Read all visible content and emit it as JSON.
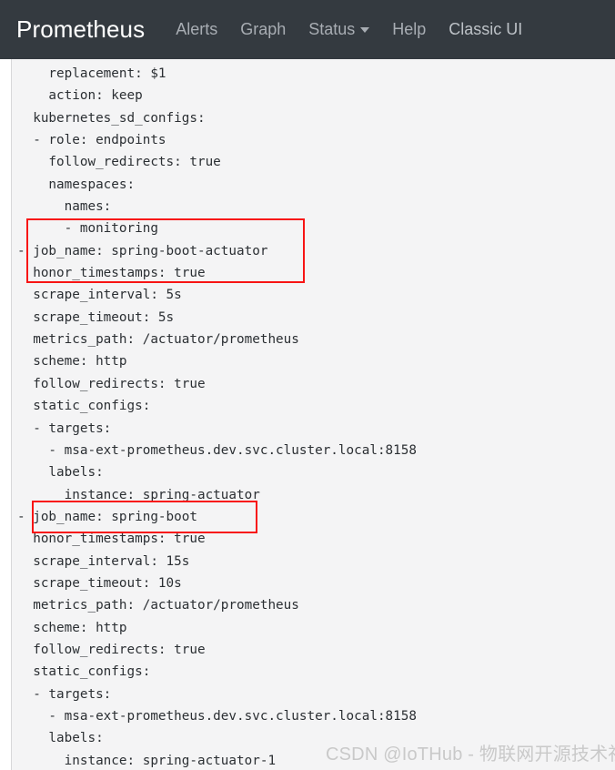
{
  "navbar": {
    "brand": "Prometheus",
    "links": [
      {
        "label": "Alerts",
        "name": "nav-link-alerts",
        "caret": false
      },
      {
        "label": "Graph",
        "name": "nav-link-graph",
        "caret": false
      },
      {
        "label": "Status",
        "name": "nav-link-status",
        "caret": true
      },
      {
        "label": "Help",
        "name": "nav-link-help",
        "caret": false
      },
      {
        "label": "Classic UI",
        "name": "nav-link-classic-ui",
        "caret": false
      }
    ]
  },
  "config": {
    "yaml": "    replacement: $1\n    action: keep\n  kubernetes_sd_configs:\n  - role: endpoints\n    follow_redirects: true\n    namespaces:\n      names:\n      - monitoring\n- job_name: spring-boot-actuator\n  honor_timestamps: true\n  scrape_interval: 5s\n  scrape_timeout: 5s\n  metrics_path: /actuator/prometheus\n  scheme: http\n  follow_redirects: true\n  static_configs:\n  - targets:\n    - msa-ext-prometheus.dev.svc.cluster.local:8158\n    labels:\n      instance: spring-actuator\n- job_name: spring-boot\n  honor_timestamps: true\n  scrape_interval: 15s\n  scrape_timeout: 10s\n  metrics_path: /actuator/prometheus\n  scheme: http\n  follow_redirects: true\n  static_configs:\n  - targets:\n    - msa-ext-prometheus.dev.svc.cluster.local:8158\n    labels:\n      instance: spring-actuator-1"
  },
  "annotations": {
    "box_color": "#f81414",
    "box_1_label": "highlight-spring-boot-actuator-job",
    "box_2_label": "highlight-spring-boot-job"
  },
  "watermark": {
    "text": "CSDN @IoTHub - 物联网开源技术社区"
  }
}
